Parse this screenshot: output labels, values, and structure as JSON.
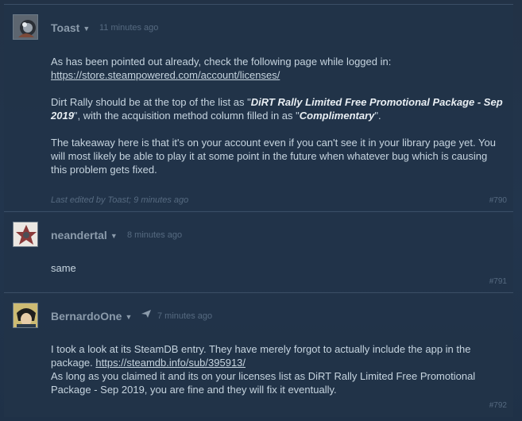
{
  "posts": [
    {
      "author": "Toast",
      "timestamp": "11 minutes ago",
      "intro": "As has been pointed out already, check the following page while logged in:",
      "link": "https://store.steampowered.com/account/licenses/",
      "p2_a": "Dirt Rally should be at the top of the list as \"",
      "p2_b": "DiRT Rally Limited Free Promotional Package - Sep 2019",
      "p2_c": "\", with the acquisition method column filled in as \"",
      "p2_d": "Complimentary",
      "p2_e": "\".",
      "p3": "The takeaway here is that it's on your account even if you can't see it in your library page yet. You will most likely be able to play it at some point in the future when whatever bug which is causing this problem gets fixed.",
      "edited": "Last edited by Toast; 9 minutes ago",
      "number": "#790"
    },
    {
      "author": "neandertal",
      "timestamp": "8 minutes ago",
      "text": "same",
      "number": "#791"
    },
    {
      "author": "BernardoOne",
      "timestamp": "7 minutes ago",
      "text_a": "I took a look at its SteamDB entry. They have merely forgot to actually include the app in the package.",
      "link": "https://steamdb.info/sub/395913/",
      "text_b": "As long as you claimed it and its on your licenses list as DiRT Rally Limited Free Promotional Package - Sep 2019, you are fine and they will fix it eventually.",
      "number": "#792"
    }
  ],
  "icons": {
    "dropdown": "chevron-down-icon",
    "badge": "paper-airplane-icon"
  },
  "colors": {
    "background": "#1b2838",
    "text": "#c6d4df",
    "author": "#8b9bab",
    "muted": "#566a80"
  }
}
